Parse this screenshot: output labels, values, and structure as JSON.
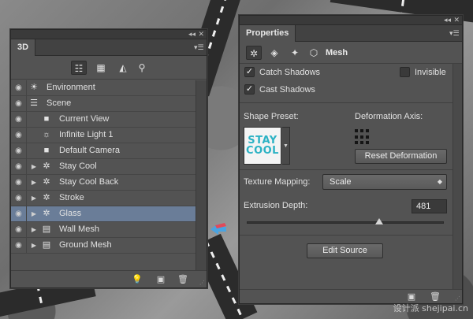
{
  "panel_3d": {
    "tab": "3D",
    "collapse_icon": "double-chevron-left-icon",
    "close_icon": "close-icon",
    "filters": [
      {
        "name": "whole-scene-filter-icon",
        "glyph": "☷",
        "active": true
      },
      {
        "name": "meshes-filter-icon",
        "glyph": "▦",
        "active": false
      },
      {
        "name": "materials-filter-icon",
        "glyph": "◭",
        "active": false
      },
      {
        "name": "lights-filter-icon",
        "glyph": "⚲",
        "active": false
      }
    ],
    "layers": [
      {
        "label": "Environment",
        "icon": "environment-icon",
        "glyph": "☀",
        "indent": 0,
        "arrow": false,
        "selected": false
      },
      {
        "label": "Scene",
        "icon": "scene-icon",
        "glyph": "☰",
        "indent": 0,
        "arrow": false,
        "selected": false
      },
      {
        "label": "Current View",
        "icon": "camera-icon",
        "glyph": "■",
        "indent": 1,
        "arrow": false,
        "selected": false
      },
      {
        "label": "Infinite Light 1",
        "icon": "light-icon",
        "glyph": "☼",
        "indent": 1,
        "arrow": false,
        "selected": false
      },
      {
        "label": "Default Camera",
        "icon": "camera-icon",
        "glyph": "■",
        "indent": 1,
        "arrow": false,
        "selected": false
      },
      {
        "label": "Stay  Cool",
        "icon": "mesh-icon",
        "glyph": "✲",
        "indent": 1,
        "arrow": true,
        "selected": false
      },
      {
        "label": "Stay  Cool Back",
        "icon": "mesh-icon",
        "glyph": "✲",
        "indent": 1,
        "arrow": true,
        "selected": false
      },
      {
        "label": "Stroke",
        "icon": "mesh-icon",
        "glyph": "✲",
        "indent": 1,
        "arrow": true,
        "selected": false
      },
      {
        "label": "Glass",
        "icon": "mesh-icon",
        "glyph": "✲",
        "indent": 1,
        "arrow": true,
        "selected": true
      },
      {
        "label": "Wall Mesh",
        "icon": "plane-mesh-icon",
        "glyph": "▤",
        "indent": 1,
        "arrow": true,
        "selected": false
      },
      {
        "label": "Ground Mesh",
        "icon": "plane-mesh-icon",
        "glyph": "▤",
        "indent": 1,
        "arrow": true,
        "selected": false
      }
    ],
    "footer": {
      "add_light": "add-light-icon",
      "render": "render-icon",
      "delete": "trash-icon"
    }
  },
  "properties": {
    "tab": "Properties",
    "toolbar_label": "Mesh",
    "tools": [
      {
        "name": "mesh-tool-icon",
        "glyph": "✲",
        "active": true
      },
      {
        "name": "deformation-tool-icon",
        "glyph": "◈",
        "active": false
      },
      {
        "name": "cap-tool-icon",
        "glyph": "✦",
        "active": false
      },
      {
        "name": "coordinates-tool-icon",
        "glyph": "⬡",
        "active": false
      }
    ],
    "catch_shadows": {
      "label": "Catch Shadows",
      "checked": true
    },
    "cast_shadows": {
      "label": "Cast Shadows",
      "checked": true
    },
    "invisible": {
      "label": "Invisible",
      "checked": false
    },
    "shape_preset_label": "Shape Preset:",
    "shape_preset_thumb_lines": [
      "STAY",
      "COOL"
    ],
    "deformation_axis_label": "Deformation Axis:",
    "reset_deformation": "Reset Deformation",
    "texture_mapping_label": "Texture Mapping:",
    "texture_mapping_value": "Scale",
    "extrusion_depth_label": "Extrusion Depth:",
    "extrusion_depth_value": "481",
    "extrusion_slider_fraction": 0.67,
    "edit_source": "Edit Source"
  },
  "watermark": "设计派 shejipai.cn"
}
